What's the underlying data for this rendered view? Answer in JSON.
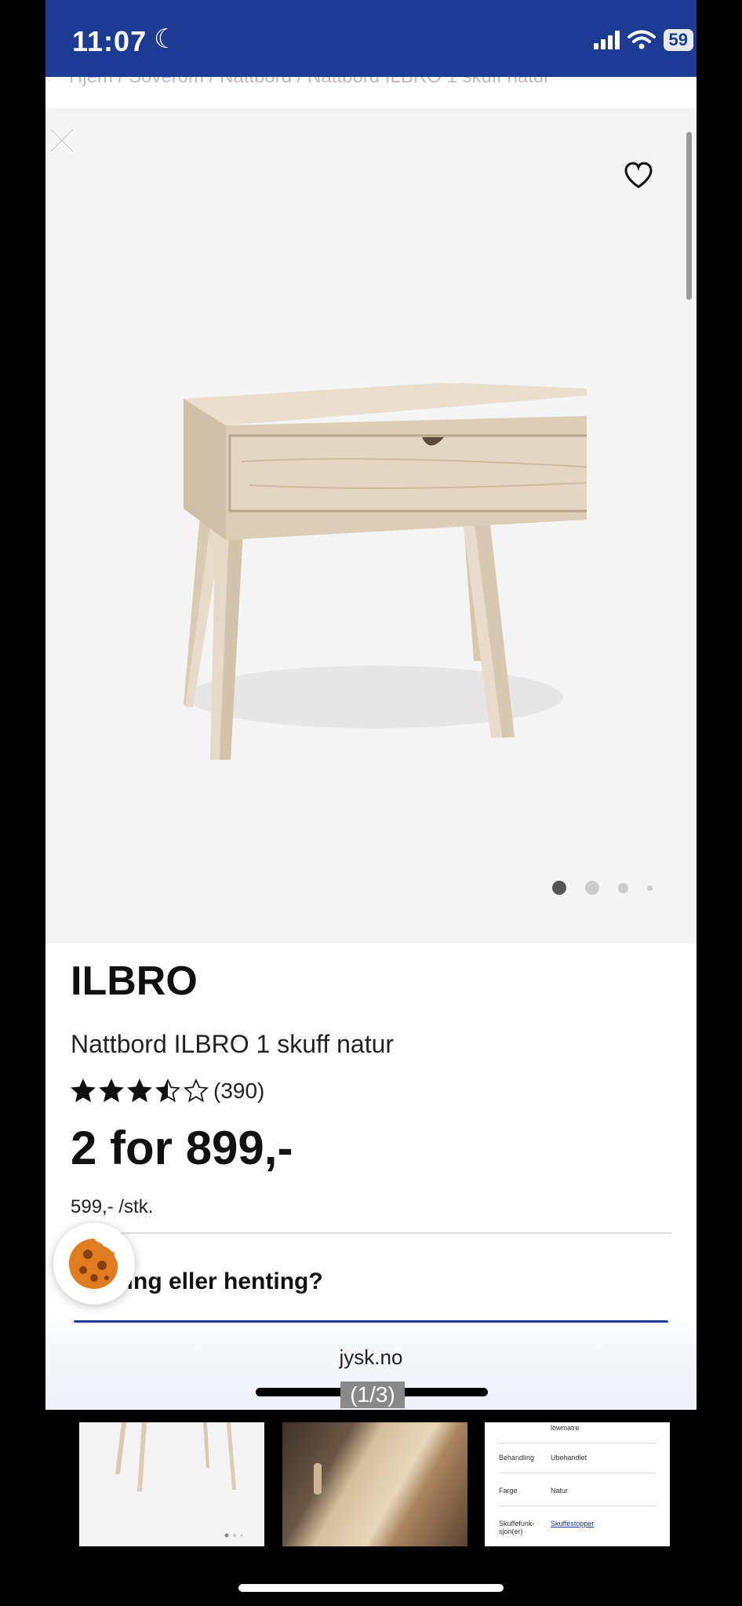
{
  "status_bar": {
    "time": "11:07",
    "battery": "59"
  },
  "breadcrumb": "Hjem  /  Soverom  /  Nattbord  /  Nattbord ILBRO 1 skuff natur",
  "product": {
    "brand": "ILBRO",
    "name": "Nattbord ILBRO 1 skuff natur",
    "rating": 3.5,
    "rating_max": 5,
    "review_count": "(390)",
    "price": "2 for 899,-",
    "unit_price": "599,- /stk."
  },
  "gallery": {
    "active_dot": 1,
    "dot_count": 4
  },
  "delivery_heading": "ring eller henting?",
  "browser": {
    "url": "jysk.no",
    "counter": "(1/3)"
  },
  "thumbnail_specs": [
    {
      "key": "",
      "value": "lowmatre"
    },
    {
      "key": "Behandling",
      "value": "Ubehandlet"
    },
    {
      "key": "Farge",
      "value": "Natur"
    },
    {
      "key": "Skuffefunk-sjon(er)",
      "value": "Skuffestopper"
    }
  ],
  "colors": {
    "brand_blue": "#1c3b95",
    "cookie_orange": "#e07b1f"
  }
}
